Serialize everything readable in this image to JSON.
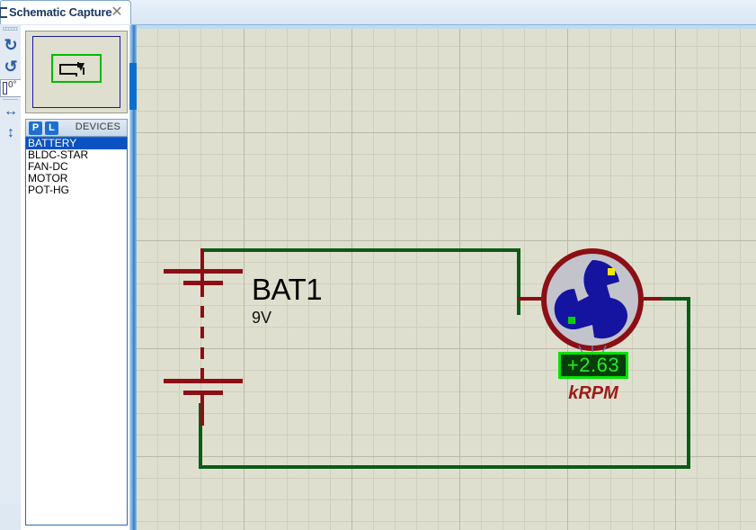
{
  "window": {
    "tab": {
      "label": "Schematic Capture",
      "close_label": "✕",
      "icon": "schematic-tab-icon"
    }
  },
  "left_toolbar": {
    "rotate_cw": "↻",
    "rotate_ccw": "↺",
    "mirror_h": "↔",
    "mirror_v": "↕",
    "angle_value": "0°"
  },
  "object_selector": {
    "preview_title": "component-preview",
    "header": {
      "pick_badge": "P",
      "library_badge": "L",
      "title": "DEVICES"
    },
    "devices": [
      {
        "name": "BATTERY",
        "selected": true
      },
      {
        "name": "BLDC-STAR",
        "selected": false
      },
      {
        "name": "FAN-DC",
        "selected": false
      },
      {
        "name": "MOTOR",
        "selected": false
      },
      {
        "name": "POT-HG",
        "selected": false
      }
    ]
  },
  "schematic": {
    "battery": {
      "reference": "BAT1",
      "value": "9V"
    },
    "motor": {
      "name": "dc-motor",
      "rotor_color": "#1414a0",
      "body_color": "#c3c3cc",
      "outline_color": "#8b0f14",
      "terminal_dot_positive": "#f5e800",
      "terminal_dot_negative": "#00d100"
    },
    "rpm_display": {
      "value": "+2.63",
      "unit": "kRPM",
      "screen_color": "#063d08",
      "text_color": "#23ef23",
      "border_color": "#00e400"
    },
    "wire_color": "#0b5c16",
    "terminal_wire_color": "#8b0f14",
    "grid_background": "#dfdfcf"
  }
}
